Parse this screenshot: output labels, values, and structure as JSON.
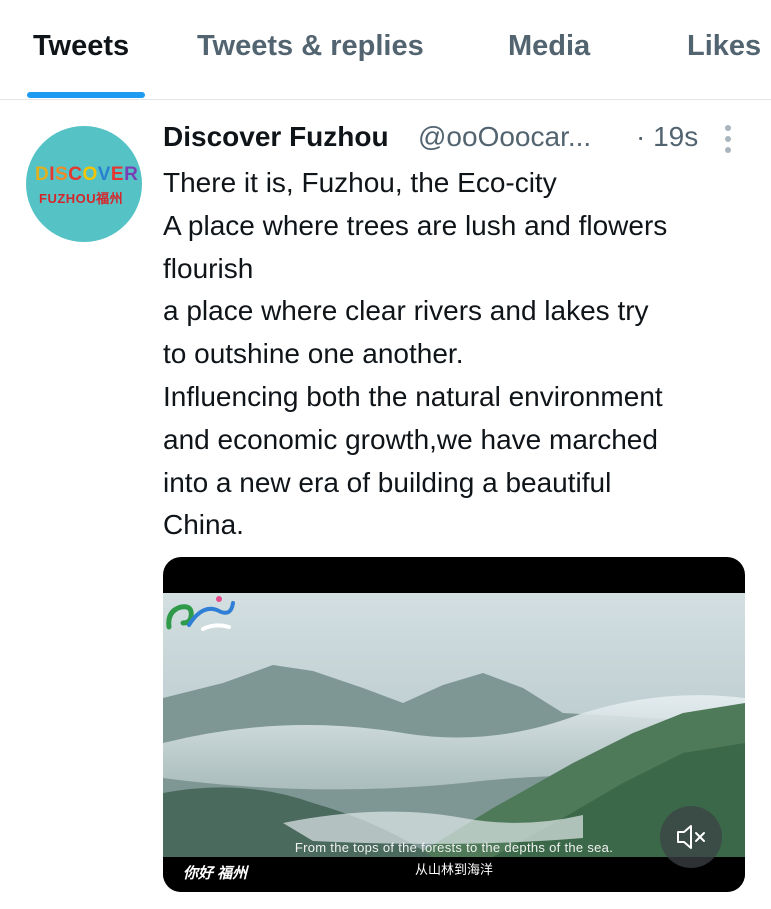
{
  "tabs": [
    {
      "label": "Tweets",
      "active": true
    },
    {
      "label": "Tweets & replies",
      "active": false
    },
    {
      "label": "Media",
      "active": false
    },
    {
      "label": "Likes",
      "active": false
    }
  ],
  "colors": {
    "accent": "#1d9bf0",
    "text_primary": "#0f1419",
    "text_secondary": "#536471",
    "avatar_bg": "#55c3c6"
  },
  "tweet": {
    "avatar": {
      "line1": "DISCOVER",
      "line2": "FUZHOU福州"
    },
    "author_name": "Discover Fuzhou",
    "author_handle": "@ooOoocar...",
    "time": "· 19s",
    "more_icon": "more-vertical-icon",
    "text_lines": [
      "There it is, Fuzhou, the Eco-city",
      "A place where trees are lush and flowers",
      "flourish",
      "a place where clear rivers and lakes try",
      "to outshine one another.",
      "Influencing both the natural environment",
      "and economic growth,we have marched",
      "into a new era of building a beautiful",
      "China."
    ],
    "video": {
      "subtitle_en": "From the tops of the forests to the depths of the sea.",
      "subtitle_cn": "从山林到海洋",
      "watermark": "你好 福州",
      "mute_icon": "speaker-muted-icon"
    }
  }
}
